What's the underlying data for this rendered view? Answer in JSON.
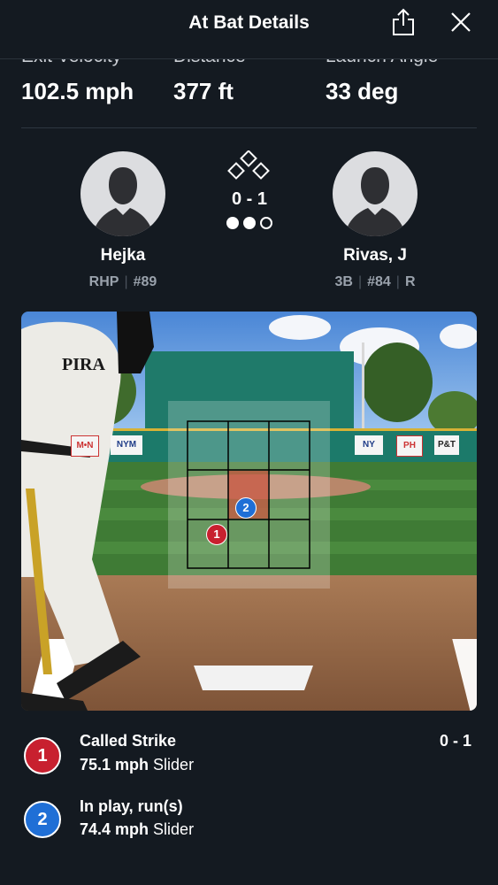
{
  "header": {
    "title": "At Bat Details",
    "share_icon": "share-icon",
    "close_icon": "close-icon"
  },
  "stats": [
    {
      "label": "Exit Velocity",
      "value": "102.5 mph"
    },
    {
      "label": "Distance",
      "value": "377 ft"
    },
    {
      "label": "Launch Angle",
      "value": "33 deg"
    }
  ],
  "matchup": {
    "pitcher": {
      "name": "Hejka",
      "throws": "RHP",
      "number": "#89"
    },
    "batter": {
      "name": "Rivas, J",
      "position": "3B",
      "number": "#84",
      "bats": "R"
    },
    "count": "0 - 1",
    "outs_filled": 2,
    "outs_total": 3
  },
  "field": {
    "ads": [
      "M•N",
      "NYM",
      "NY",
      "PH",
      "P&T"
    ],
    "pitch_markers": [
      "1",
      "2"
    ]
  },
  "pitches": [
    {
      "number": "1",
      "result": "Called Strike",
      "speed": "75.1 mph",
      "type": "Slider",
      "count": "0 - 1",
      "color": "#c8202f"
    },
    {
      "number": "2",
      "result": "In play, run(s)",
      "speed": "74.4 mph",
      "type": "Slider",
      "count": "",
      "color": "#1f6fd6"
    }
  ]
}
